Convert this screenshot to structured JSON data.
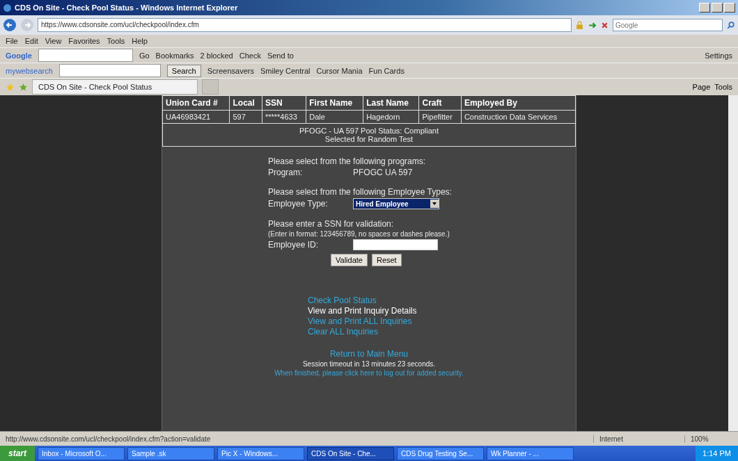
{
  "window": {
    "title": "CDS On Site - Check Pool Status - Windows Internet Explorer"
  },
  "address_bar": {
    "url": "https://www.cdsonsite.com/ucl/checkpool/index.cfm",
    "search_placeholder": "Google"
  },
  "menu": [
    "File",
    "Edit",
    "View",
    "Favorites",
    "Tools",
    "Help"
  ],
  "google_toolbar": {
    "label": "Google",
    "items": [
      "Go",
      "Bookmarks",
      "2 blocked",
      "Check",
      "Send to"
    ],
    "settings": "Settings"
  },
  "web_toolbar": {
    "label": "mywebsearch",
    "search_button": "Search",
    "links": [
      "Screensavers",
      "Smiley Central",
      "Cursor Mania",
      "Fun Cards"
    ]
  },
  "tab": {
    "title": "CDS On Site - Check Pool Status"
  },
  "command_bar": [
    "Page",
    "Tools"
  ],
  "table": {
    "columns": [
      "Union Card #",
      "Local",
      "SSN",
      "First Name",
      "Last Name",
      "Craft",
      "Employed By"
    ],
    "rows": [
      [
        "UA46983421",
        "597",
        "*****4633",
        "Dale",
        "Hagedorn",
        "Pipefitter",
        "Construction Data Services"
      ]
    ],
    "status": [
      "PFOGC - UA 597 Pool Status: Compliant",
      "Selected for Random Test"
    ]
  },
  "form": {
    "program_prompt": "Please select from the following programs:",
    "program_label": "Program:",
    "program_value": "PFOGC   UA 597",
    "type_prompt": "Please select from the following Employee Types:",
    "type_label": "Employee Type:",
    "type_value": "Hired Employee",
    "ssn_prompt": "Please enter a SSN for validation:",
    "ssn_hint": "(Enter in format: 123456789, no spaces or dashes please.)",
    "id_label": "Employee ID:",
    "buttons": [
      "Validate",
      "Reset"
    ]
  },
  "links": [
    {
      "text": "Check Pool Status",
      "kind": "link"
    },
    {
      "text": "View and Print Inquiry Details",
      "kind": "text"
    },
    {
      "text": "View and Print ALL Inquiries",
      "kind": "link"
    },
    {
      "text": "Clear ALL Inquiries",
      "kind": "link"
    }
  ],
  "main_menu_link": "Return to Main Menu",
  "session": "Session timeout in 13 minutes 23 seconds.",
  "logout_link": "When finished, please click here to log out for added security.",
  "status_bar": {
    "text": "http://www.cdsonsite.com/ucl/checkpool/index.cfm?action=validate",
    "zone": "Internet",
    "zoom": "100%"
  },
  "taskbar": {
    "start": "start",
    "items": [
      {
        "label": "Inbox - Microsoft O...",
        "selected": false
      },
      {
        "label": "Sample .sk",
        "selected": false
      },
      {
        "label": "Pic X - Windows...",
        "selected": false
      },
      {
        "label": "CDS On Site - Che...",
        "selected": true
      },
      {
        "label": "CDS Drug Testing Se...",
        "selected": false
      },
      {
        "label": "Wk Planner - ...",
        "selected": false
      }
    ],
    "clock": "1:14 PM"
  }
}
